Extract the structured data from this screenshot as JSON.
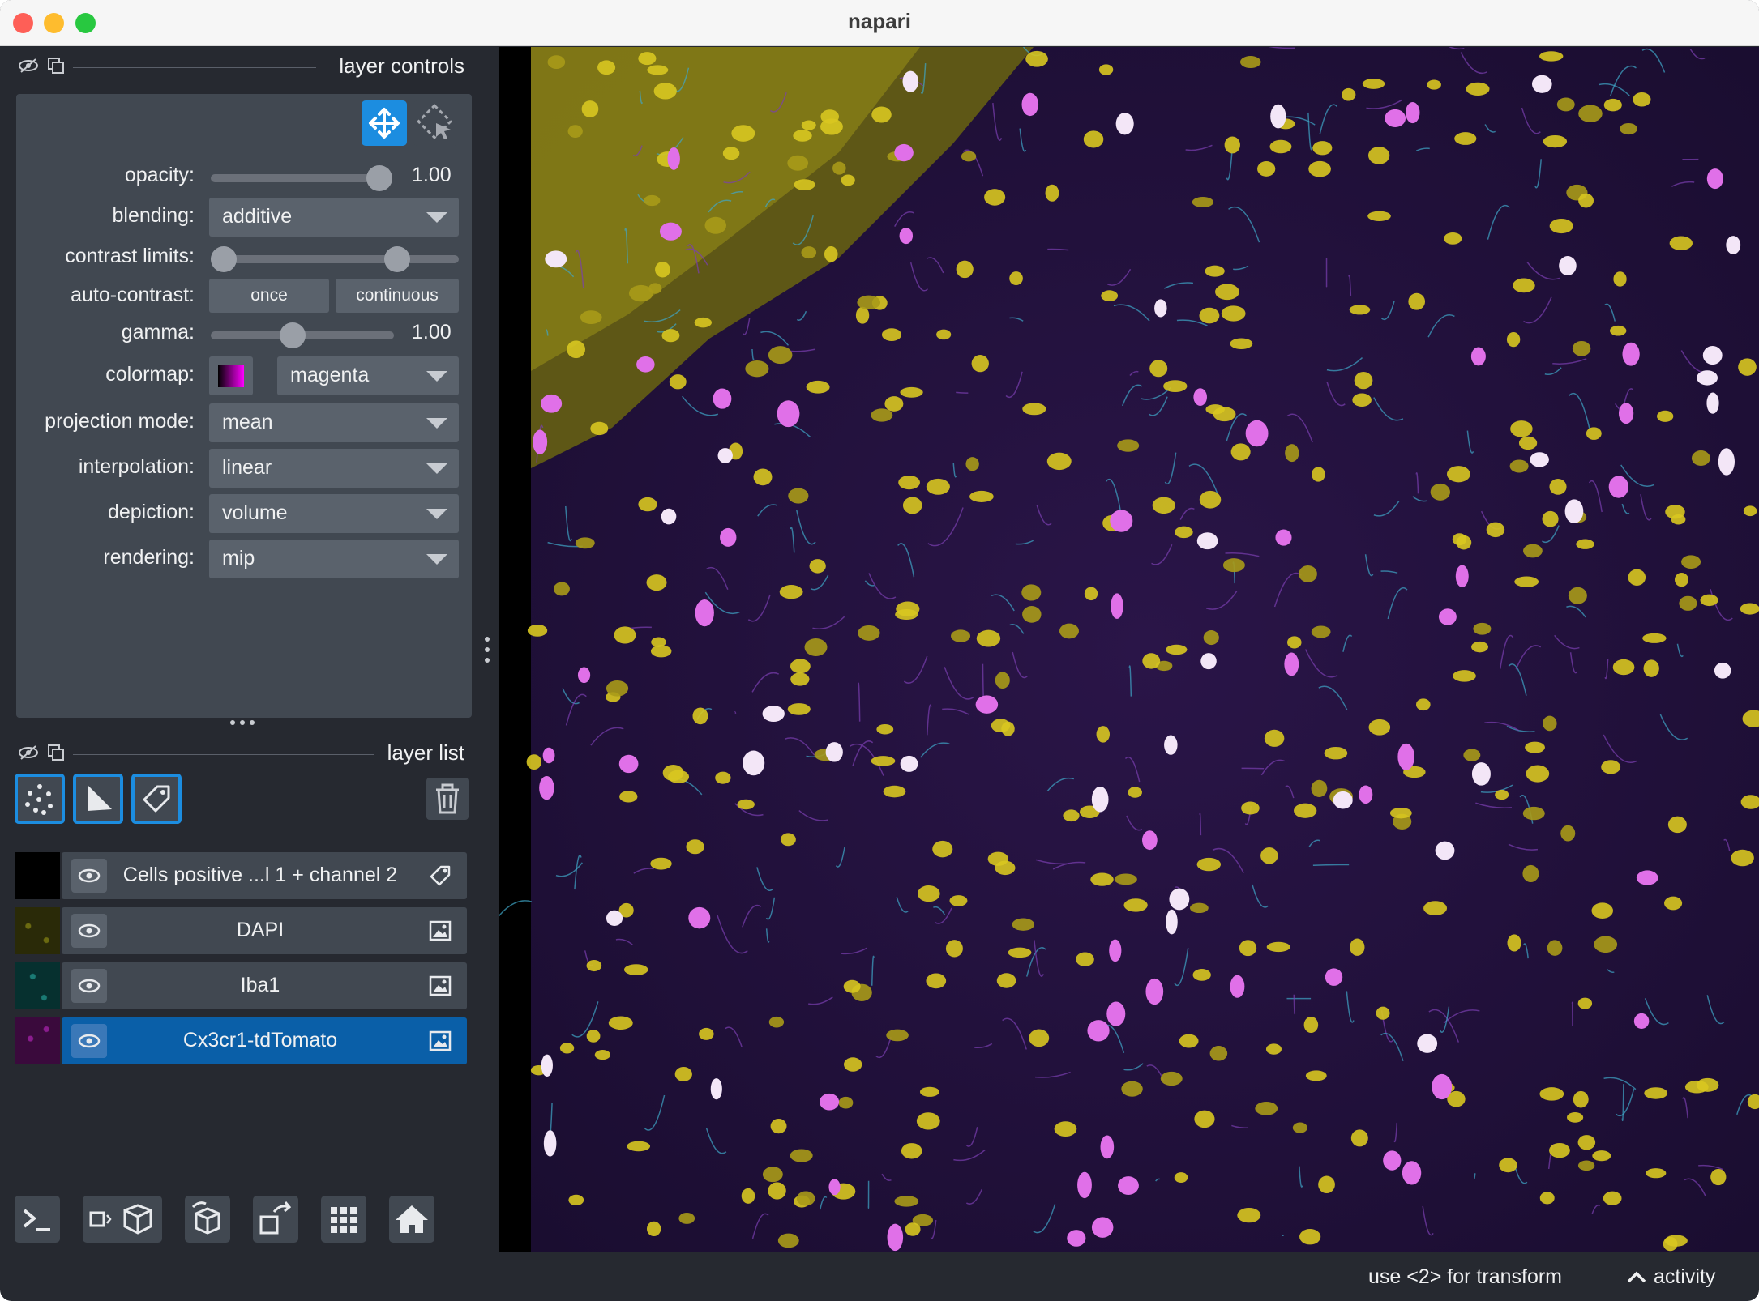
{
  "window": {
    "title": "napari"
  },
  "layer_controls": {
    "title": "layer controls",
    "opacity": {
      "label": "opacity:",
      "value_text": "1.00",
      "value": 1.0
    },
    "blending": {
      "label": "blending:",
      "value": "additive"
    },
    "contrast_limits": {
      "label": "contrast limits:",
      "low": 0.0,
      "high": 0.75
    },
    "auto_contrast": {
      "label": "auto-contrast:",
      "once": "once",
      "continuous": "continuous"
    },
    "gamma": {
      "label": "gamma:",
      "value_text": "1.00",
      "value": 0.45
    },
    "colormap": {
      "label": "colormap:",
      "value": "magenta"
    },
    "projection_mode": {
      "label": "projection mode:",
      "value": "mean"
    },
    "interpolation": {
      "label": "interpolation:",
      "value": "linear"
    },
    "depiction": {
      "label": "depiction:",
      "value": "volume"
    },
    "rendering": {
      "label": "rendering:",
      "value": "mip"
    }
  },
  "layer_list": {
    "title": "layer list",
    "layers": [
      {
        "name": "Cells positive ...l 1 + channel 2",
        "type": "labels-icon",
        "thumb": "#000000",
        "selected": false
      },
      {
        "name": "DAPI",
        "type": "image-icon",
        "thumb": "#2a2a08",
        "selected": false
      },
      {
        "name": "Iba1",
        "type": "image-icon",
        "thumb": "#06302f",
        "selected": false
      },
      {
        "name": "Cx3cr1-tdTomato",
        "type": "image-icon",
        "thumb": "#3a0a3c",
        "selected": true
      }
    ]
  },
  "status": {
    "hint": "use <2> for transform",
    "activity": "activity"
  },
  "colors": {
    "accent": "#1c8de0",
    "panel": "#414851",
    "background": "#262930",
    "selected_layer": "#0a5fa8"
  }
}
